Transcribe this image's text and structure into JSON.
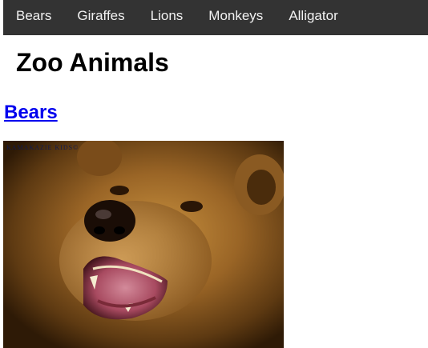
{
  "nav": {
    "items": [
      {
        "label": "Bears"
      },
      {
        "label": "Giraffes"
      },
      {
        "label": "Lions"
      },
      {
        "label": "Monkeys"
      },
      {
        "label": "Alligator"
      }
    ]
  },
  "main": {
    "title": "Zoo Animals",
    "section": {
      "label": "Bears",
      "image": {
        "watermark": "KAMAKAZIE KIDS©"
      }
    }
  }
}
